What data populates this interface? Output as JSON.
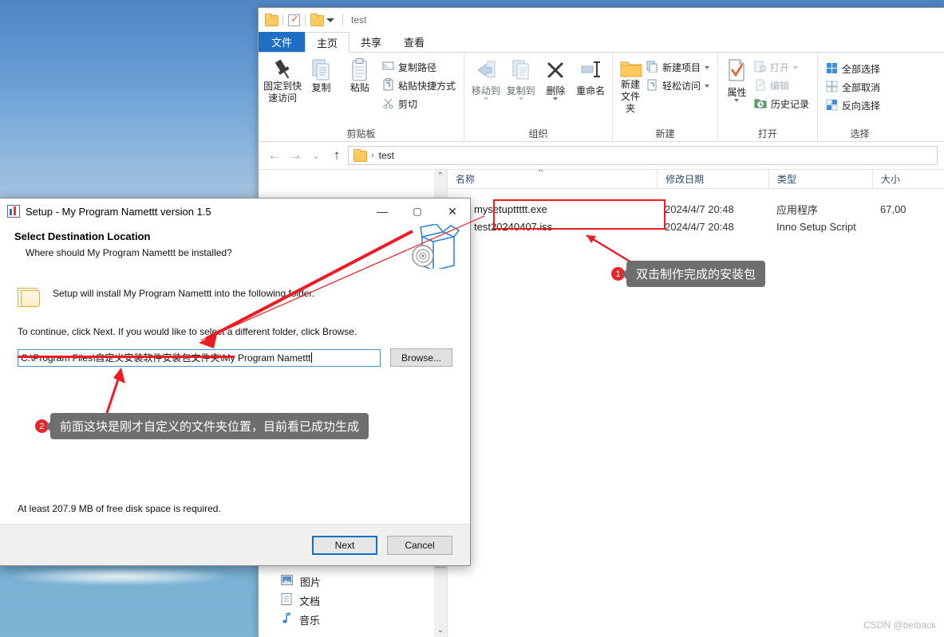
{
  "desktop": {
    "name": "windows-desktop-wallpaper"
  },
  "explorer": {
    "quick_access": {
      "folder_icon": "folder-icon",
      "checklist_icon": "properties-checklist-icon",
      "new_folder_icon": "new-folder-icon",
      "dropdown_icon": "chevron-down-icon",
      "title": "test"
    },
    "tabs": [
      {
        "label": "文件",
        "id": "file"
      },
      {
        "label": "主页",
        "id": "home"
      },
      {
        "label": "共享",
        "id": "share"
      },
      {
        "label": "查看",
        "id": "view"
      }
    ],
    "active_tab": "主页",
    "ribbon": {
      "groups": [
        {
          "name": "剪贴板",
          "big": [
            {
              "label_line1": "固定到快",
              "label_line2": "速访问",
              "icon": "pin-icon"
            },
            {
              "label_line1": "复制",
              "label_line2": "",
              "icon": "copy-icon"
            },
            {
              "label_line1": "粘贴",
              "label_line2": "",
              "icon": "paste-icon"
            }
          ],
          "small": [
            {
              "label": "复制路径",
              "icon": "copy-path-icon"
            },
            {
              "label": "粘贴快捷方式",
              "icon": "paste-shortcut-icon"
            },
            {
              "label": "剪切",
              "icon": "scissors-icon"
            }
          ]
        },
        {
          "name": "组织",
          "big": [
            {
              "label_line1": "移动到",
              "label_line2": "",
              "icon": "move-to-icon",
              "dim": true,
              "has_caret": true
            },
            {
              "label_line1": "复制到",
              "label_line2": "",
              "icon": "copy-to-icon",
              "dim": true,
              "has_caret": true
            },
            {
              "label_line1": "删除",
              "label_line2": "",
              "icon": "delete-x-icon",
              "has_caret": true
            },
            {
              "label_line1": "重命名",
              "label_line2": "",
              "icon": "rename-icon"
            }
          ],
          "small": []
        },
        {
          "name": "新建",
          "big": [
            {
              "label_line1": "新建",
              "label_line2": "文件夹",
              "icon": "new-folder-icon"
            }
          ],
          "small": [
            {
              "label": "新建项目",
              "icon": "new-item-icon",
              "has_caret": true
            },
            {
              "label": "轻松访问",
              "icon": "easy-access-icon",
              "has_caret": true
            }
          ]
        },
        {
          "name": "打开",
          "big": [
            {
              "label_line1": "属性",
              "label_line2": "",
              "icon": "properties-icon",
              "has_caret": true
            }
          ],
          "small": [
            {
              "label": "打开",
              "icon": "open-icon",
              "dim": true,
              "has_caret": true
            },
            {
              "label": "编辑",
              "icon": "edit-icon",
              "dim": true
            },
            {
              "label": "历史记录",
              "icon": "history-icon"
            }
          ]
        },
        {
          "name": "选择",
          "big": [],
          "small": [
            {
              "label": "全部选择",
              "icon": "select-all-icon"
            },
            {
              "label": "全部取消",
              "icon": "select-none-icon"
            },
            {
              "label": "反向选择",
              "icon": "invert-selection-icon"
            }
          ]
        }
      ]
    },
    "address_bar": {
      "back_icon": "back-arrow-icon",
      "forward_icon": "forward-arrow-icon",
      "recent_icon": "recent-locations-icon",
      "up_icon": "up-arrow-icon",
      "folder_icon": "folder-icon",
      "crumb": "test"
    },
    "nav_pane": {
      "items": [
        {
          "label": "图片",
          "icon": "pictures-icon"
        },
        {
          "label": "文档",
          "icon": "documents-icon"
        },
        {
          "label": "音乐",
          "icon": "music-note-icon"
        }
      ],
      "scrollbar_up_icon": "scroll-up-icon",
      "scrollbar_down_icon": "scroll-down-icon"
    },
    "file_list": {
      "columns": [
        "名称",
        "修改日期",
        "类型",
        "大小"
      ],
      "sort_indicator": "^",
      "rows": [
        {
          "name": "mysetupttttt.exe",
          "date": "2024/4/7 20:48",
          "type": "应用程序",
          "size": "67,00",
          "icon": "exe-file-icon",
          "highlighted": true
        },
        {
          "name": "test20240407.iss",
          "date": "2024/4/7 20:48",
          "type": "Inno Setup Script",
          "size": "",
          "icon": "iss-file-icon",
          "highlighted": false
        }
      ]
    }
  },
  "setup_dialog": {
    "title": "Setup - My Program Namettt version 1.5",
    "app_icon": "setup-app-icon",
    "window_buttons": {
      "minimize": "—",
      "maximize": "▢",
      "close": "✕"
    },
    "heading": "Select Destination Location",
    "subheading": "Where should My Program Namettt be installed?",
    "box_art_icon": "installer-box-icon",
    "folder_icon": "folder-icon",
    "line1": "Setup will install My Program Namettt into the following folder.",
    "line2": "To continue, click Next. If you would like to select a different folder, click Browse.",
    "path_value": "C:\\Program Files\\自定义安装软件安装包文件夹\\My Program Namettt",
    "browse_label": "Browse...",
    "disk_space": "At least 207.9 MB of free disk space is required.",
    "next_label": "Next",
    "cancel_label": "Cancel"
  },
  "annotations": {
    "callout1": {
      "number": "1",
      "text": "双击制作完成的安装包"
    },
    "callout2": {
      "number": "2",
      "text": "前面这块是刚才自定义的文件夹位置，目前看已成功生成"
    },
    "accent_color": "#ec1c24"
  },
  "watermark": "CSDN @beiback"
}
